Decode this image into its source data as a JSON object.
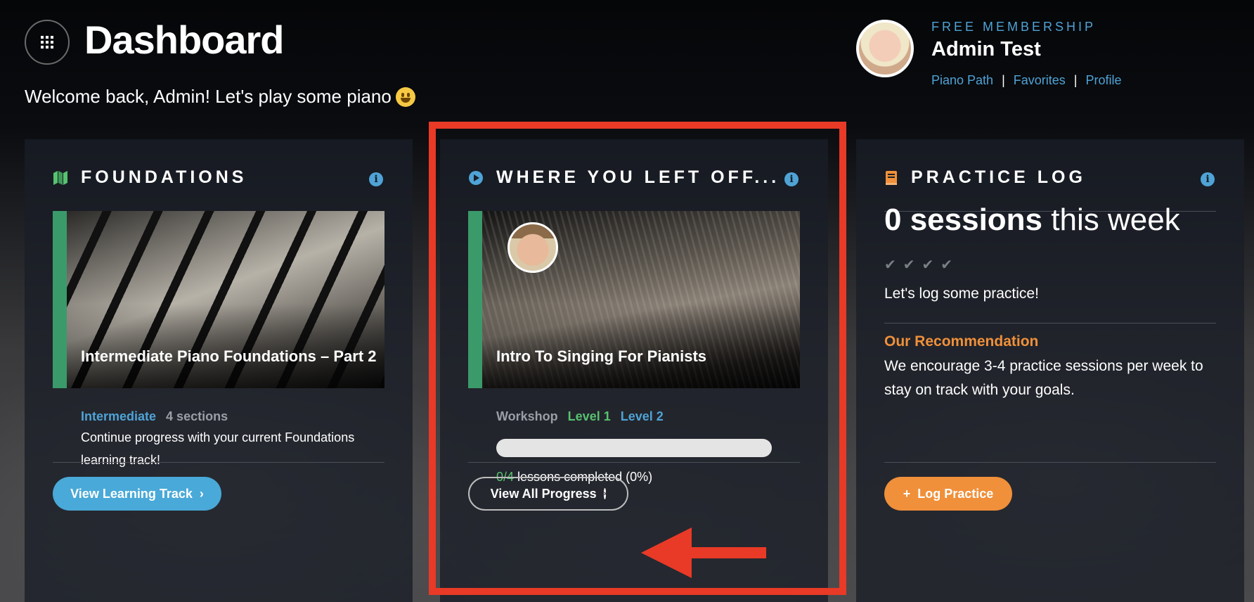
{
  "header": {
    "title": "Dashboard",
    "welcome": "Welcome back, Admin! Let's play some piano"
  },
  "profile": {
    "membership": "FREE MEMBERSHIP",
    "name": "Admin Test",
    "links": [
      "Piano Path",
      "Favorites",
      "Profile"
    ],
    "separator": "|"
  },
  "foundations": {
    "title": "FOUNDATIONS",
    "course_title": "Intermediate Piano Foundations – Part 2",
    "level": "Intermediate",
    "sections": "4 sections",
    "description": "Continue progress with your current Foundations learning track!",
    "button": "View Learning Track",
    "button_arrow": "›"
  },
  "left_off": {
    "title": "WHERE YOU LEFT OFF...",
    "course_title": "Intro To Singing For Pianists",
    "type": "Workshop",
    "levels": [
      "Level 1",
      "Level 2"
    ],
    "progress_fraction": 0,
    "progress_count": "0/4",
    "progress_text": "lessons completed (0%)",
    "button": "View All Progress",
    "button_arrow": "›"
  },
  "practice_log": {
    "title": "PRACTICE LOG",
    "sessions_count": "0 sessions",
    "sessions_suffix": "this week",
    "checks": "✔✔✔✔",
    "cta": "Let's log some practice!",
    "recommendation_title": "Our Recommendation",
    "recommendation_text": "We encourage 3-4 practice sessions per week to stay on track with your goals.",
    "button_plus": "+",
    "button": "Log Practice"
  },
  "colors": {
    "accent_blue": "#4fa3d6",
    "accent_green": "#58c170",
    "accent_orange": "#f0903a",
    "highlight_red": "#e83a26"
  },
  "icons": {
    "menu": "grid-icon",
    "foundations": "map-icon",
    "left_off": "play-circle-icon",
    "practice": "book-icon",
    "info": "info-icon"
  }
}
